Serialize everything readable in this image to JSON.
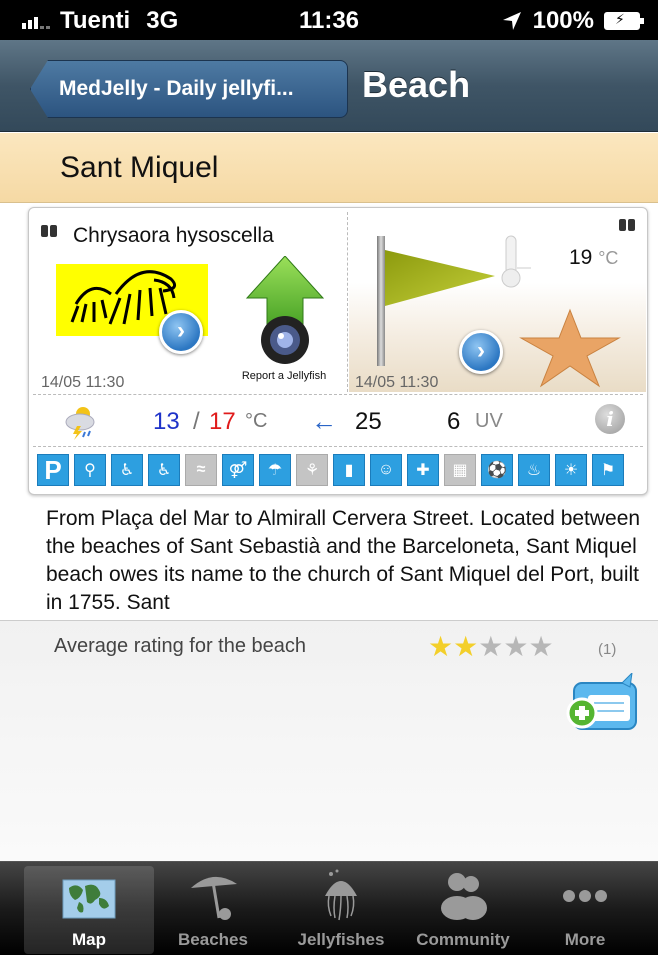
{
  "status_bar": {
    "carrier": "Tuenti",
    "network": "3G",
    "time": "11:36",
    "battery": "100%",
    "icons": [
      "signal-icon",
      "location-arrow-icon",
      "battery-icon"
    ]
  },
  "nav": {
    "back_label": "MedJelly - Daily jellyfi...",
    "title": "Beach"
  },
  "beach": {
    "name": "Sant Miquel"
  },
  "jellyfish": {
    "species": "Chrysaora hysoscella",
    "report_label": "Report a Jellyfish",
    "timestamp": "14/05 11:30"
  },
  "conditions": {
    "water_temp": "19",
    "water_temp_unit": "°C",
    "timestamp": "14/05 11:30",
    "flag_color": "#a8b312"
  },
  "forecast": {
    "temp_min": "13",
    "separator": "/",
    "temp_max": "17",
    "temp_unit": "°C",
    "wind_arrow": "←",
    "wind": "25",
    "uv": "6",
    "uv_unit": "UV",
    "info": "i"
  },
  "services": [
    {
      "icon": "parking-icon",
      "glyph": "P",
      "available": true
    },
    {
      "icon": "bike-icon",
      "glyph": "⚲",
      "available": true
    },
    {
      "icon": "wheelchair-icon",
      "glyph": "♿",
      "available": true
    },
    {
      "icon": "accessible-bath-icon",
      "glyph": "♿",
      "available": true
    },
    {
      "icon": "pool-icon",
      "glyph": "≈",
      "available": false
    },
    {
      "icon": "toilets-icon",
      "glyph": "⚤",
      "available": true
    },
    {
      "icon": "shower-icon",
      "glyph": "☂",
      "available": true
    },
    {
      "icon": "tap-icon",
      "glyph": "⚘",
      "available": false
    },
    {
      "icon": "bin-icon",
      "glyph": "▮",
      "available": true
    },
    {
      "icon": "lost-child-icon",
      "glyph": "☺",
      "available": true
    },
    {
      "icon": "lifeguard-icon",
      "glyph": "✚",
      "available": true
    },
    {
      "icon": "lockers-icon",
      "glyph": "▦",
      "available": false
    },
    {
      "icon": "sports-icon",
      "glyph": "⚽",
      "available": true
    },
    {
      "icon": "restaurant-icon",
      "glyph": "♨",
      "available": true
    },
    {
      "icon": "hammock-icon",
      "glyph": "☀",
      "available": true
    },
    {
      "icon": "info-point-icon",
      "glyph": "⚑",
      "available": true
    }
  ],
  "description": "From Plaça del Mar to Almirall Cervera Street. Located between the beaches of Sant Sebastià and the Barceloneta, Sant Miquel beach owes its name to the church of Sant Miquel del Port, built in 1755. Sant",
  "rating": {
    "label": "Average rating for the beach",
    "value": 2,
    "max": 5,
    "count": "(1)"
  },
  "tabs": [
    {
      "label": "Map",
      "icon": "world-map-icon",
      "active": true
    },
    {
      "label": "Beaches",
      "icon": "beach-umbrella-icon",
      "active": false
    },
    {
      "label": "Jellyfishes",
      "icon": "jellyfish-icon",
      "active": false
    },
    {
      "label": "Community",
      "icon": "people-icon",
      "active": false
    },
    {
      "label": "More",
      "icon": "more-dots-icon",
      "active": false
    }
  ]
}
